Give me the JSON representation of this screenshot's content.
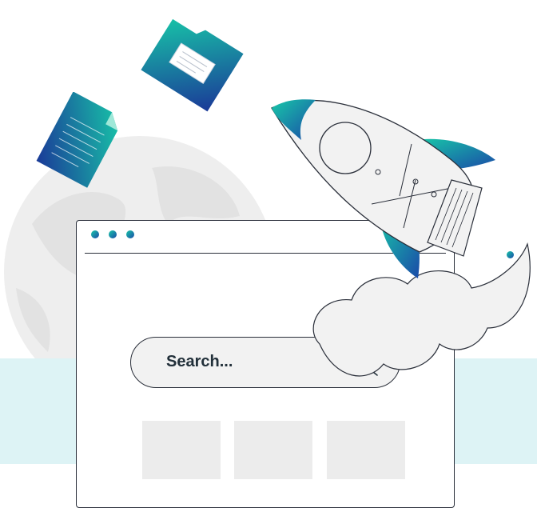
{
  "search": {
    "placeholder": "Search..."
  },
  "colors": {
    "accent_start": "#18c8a8",
    "accent_end": "#1a4aa8",
    "band": "#ddf3f5",
    "globe": "#eeeeee"
  },
  "icons": [
    "globe-icon",
    "rocket-icon",
    "folder-icon",
    "document-icon",
    "search-icon"
  ],
  "result_tiles": 3
}
